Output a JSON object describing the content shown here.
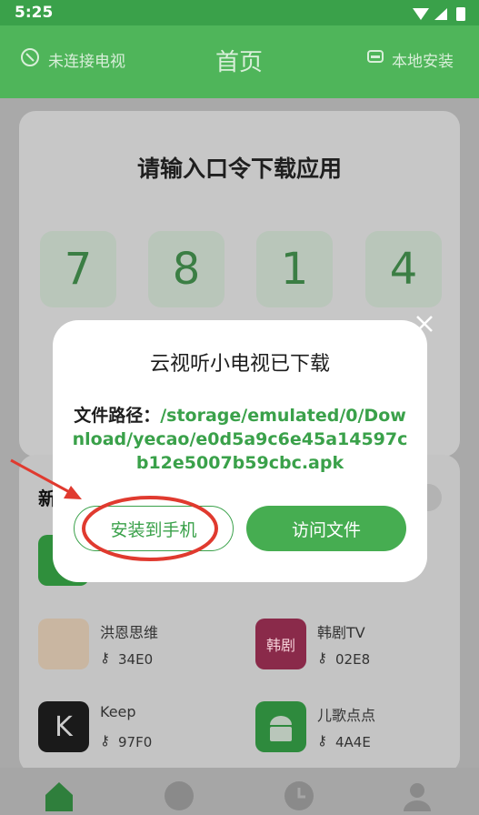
{
  "status_bar": {
    "time": "5:25"
  },
  "header": {
    "left": "未连接电视",
    "title": "首页",
    "right": "本地安装"
  },
  "download_card": {
    "heading": "请输入口令下载应用",
    "digits": [
      "7",
      "8",
      "1",
      "4"
    ]
  },
  "new_section": {
    "label": "新",
    "apps": [
      {
        "name": "洪恩思维",
        "code": "34E0"
      },
      {
        "name": "韩剧TV",
        "code": "02E8"
      },
      {
        "name": "Keep",
        "code": "97F0"
      },
      {
        "name": "儿歌点点",
        "code": "4A4E"
      }
    ],
    "hanju_logo": "韩剧"
  },
  "dialog": {
    "title": "云视听小电视已下载",
    "path_label": "文件路径：",
    "path_value": "/storage/emulated/0/Download/yecao/e0d5a9c6e45a14597cb12e5007b59cbc.apk",
    "install_label": "安装到手机",
    "visit_label": "访问文件"
  },
  "colors": {
    "accent": "#3aa14a",
    "annotation": "#e03a2f"
  }
}
